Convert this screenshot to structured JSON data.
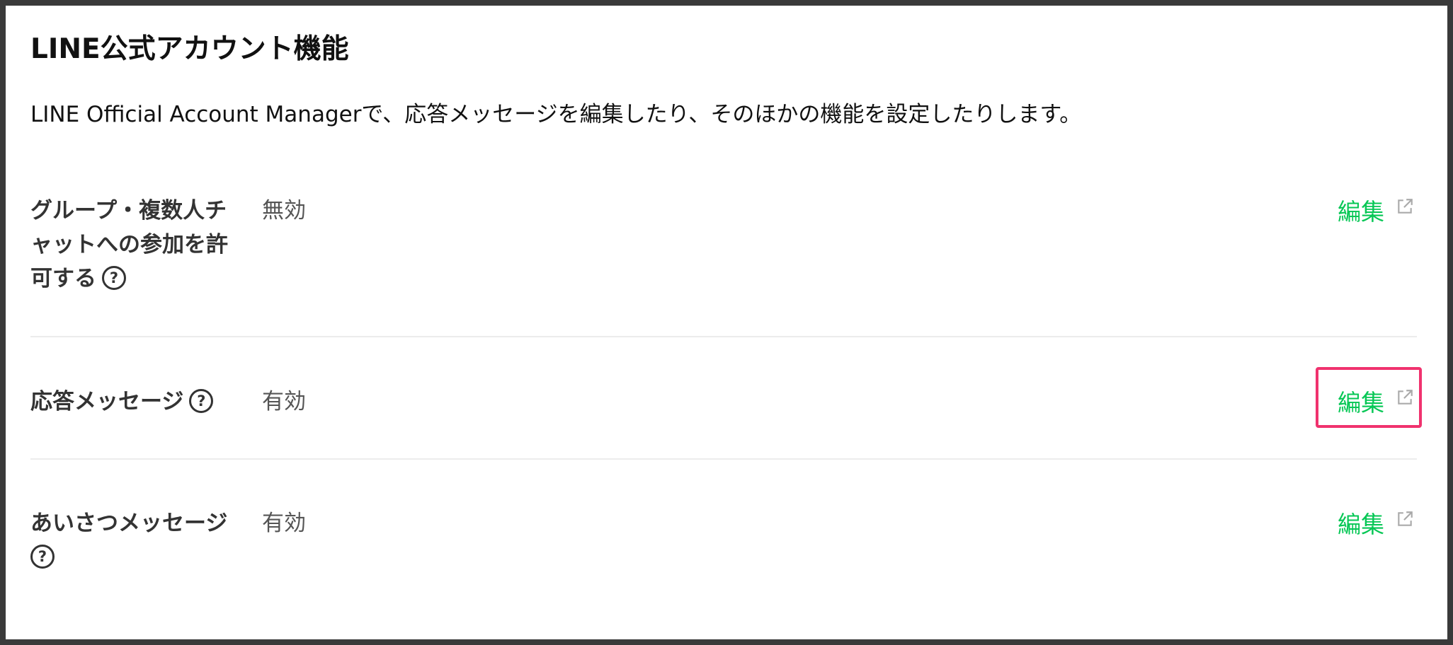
{
  "section": {
    "title": "LINE公式アカウント機能",
    "description": "LINE Official Account Managerで、応答メッセージを編集したり、そのほかの機能を設定したりします。"
  },
  "rows": [
    {
      "label_line1": "グループ・複数人チ",
      "label_line2": "ャットへの参加を許",
      "label_line3": "可する",
      "value": "無効",
      "edit_label": "編集"
    },
    {
      "label_line1": "応答メッセージ",
      "value": "有効",
      "edit_label": "編集"
    },
    {
      "label_line1": "あいさつメッセージ",
      "value": "有効",
      "edit_label": "編集"
    }
  ],
  "icons": {
    "help": "question-circle-icon",
    "external": "external-link-icon",
    "help_glyph": "?"
  },
  "colors": {
    "link_green": "#06c755",
    "highlight": "#f0326e"
  }
}
